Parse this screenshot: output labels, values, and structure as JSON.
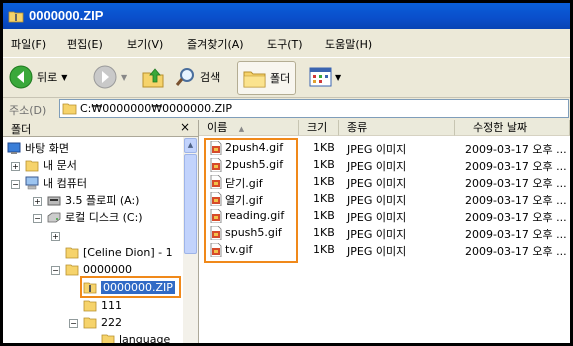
{
  "window": {
    "title": "0000000.ZIP"
  },
  "menu": [
    "파일(F)",
    "편집(E)",
    "보기(V)",
    "즐겨찾기(A)",
    "도구(T)",
    "도움말(H)"
  ],
  "toolbar": {
    "back": "뒤로",
    "search": "검색",
    "folders": "폴더"
  },
  "address": {
    "label": "주소(D)",
    "value": "C:₩0000000₩0000000.ZIP"
  },
  "folder_pane": {
    "header": "폴더",
    "close": "×",
    "tree": [
      "바탕 화면",
      "내 문서",
      "내 컴퓨터",
      "3.5 플로피 (A:)",
      "로컬 디스크 (C:)",
      "",
      "[Celine Dion] - 1",
      "0000000",
      "0000000.ZIP",
      "111",
      "222",
      "language"
    ]
  },
  "columns": {
    "name": "이름",
    "size": "크기",
    "type": "종류",
    "modified": "수정한 날짜"
  },
  "files": [
    {
      "name": "2push4.gif",
      "size": "1KB",
      "type": "JPEG 이미지",
      "modified": "2009-03-17 오후 ..."
    },
    {
      "name": "2push5.gif",
      "size": "1KB",
      "type": "JPEG 이미지",
      "modified": "2009-03-17 오후 ..."
    },
    {
      "name": "닫기.gif",
      "size": "1KB",
      "type": "JPEG 이미지",
      "modified": "2009-03-17 오후 ..."
    },
    {
      "name": "열기.gif",
      "size": "1KB",
      "type": "JPEG 이미지",
      "modified": "2009-03-17 오후 ..."
    },
    {
      "name": "reading.gif",
      "size": "1KB",
      "type": "JPEG 이미지",
      "modified": "2009-03-17 오후 ..."
    },
    {
      "name": "spush5.gif",
      "size": "1KB",
      "type": "JPEG 이미지",
      "modified": "2009-03-17 오후 ..."
    },
    {
      "name": "tv.gif",
      "size": "1KB",
      "type": "JPEG 이미지",
      "modified": "2009-03-17 오후 ..."
    }
  ],
  "colors": {
    "titlebar": "#0a4fcc",
    "highlight": "#f0891a",
    "selection": "#316ac5"
  }
}
